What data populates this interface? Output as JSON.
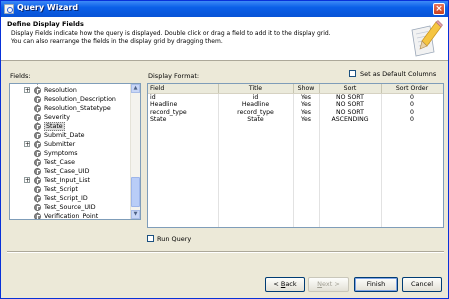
{
  "window": {
    "title": "Query Wizard",
    "close_label": "×"
  },
  "header": {
    "title": "Define Display Fields",
    "description_line1": "Display Fields indicate how the query is displayed. Double click or drag a field to add it to the display grid.",
    "description_line2": "You can also rearrange the fields in the display grid by dragging them."
  },
  "fields_panel": {
    "label": "Fields:",
    "items": [
      {
        "label": "Resolution",
        "expandable": true,
        "selected": false
      },
      {
        "label": "Resolution_Description",
        "expandable": false,
        "selected": false
      },
      {
        "label": "Resolution_Statetype",
        "expandable": false,
        "selected": false
      },
      {
        "label": "Severity",
        "expandable": false,
        "selected": false
      },
      {
        "label": "State",
        "expandable": false,
        "selected": true
      },
      {
        "label": "Submit_Date",
        "expandable": false,
        "selected": false
      },
      {
        "label": "Submitter",
        "expandable": true,
        "selected": false
      },
      {
        "label": "Symptoms",
        "expandable": false,
        "selected": false
      },
      {
        "label": "Test_Case",
        "expandable": false,
        "selected": false
      },
      {
        "label": "Test_Case_UID",
        "expandable": false,
        "selected": false
      },
      {
        "label": "Test_Input_List",
        "expandable": true,
        "selected": false
      },
      {
        "label": "Test_Script",
        "expandable": false,
        "selected": false
      },
      {
        "label": "Test_Script_ID",
        "expandable": false,
        "selected": false
      },
      {
        "label": "Test_Source_UID",
        "expandable": false,
        "selected": false
      },
      {
        "label": "Verification_Point",
        "expandable": false,
        "selected": false
      }
    ]
  },
  "display_panel": {
    "label": "Display Format:",
    "default_columns_label": "Set as Default Columns",
    "columns": [
      "Field",
      "Title",
      "Show",
      "Sort",
      "Sort Order"
    ],
    "rows": [
      [
        "id",
        "id",
        "Yes",
        "NO SORT",
        "0"
      ],
      [
        "Headline",
        "Headline",
        "Yes",
        "NO SORT",
        "0"
      ],
      [
        "record_type",
        "record_type",
        "Yes",
        "NO SORT",
        "0"
      ],
      [
        "State",
        "State",
        "Yes",
        "ASCENDING",
        "0"
      ]
    ]
  },
  "run_query_label": "Run Query",
  "buttons": {
    "back_prefix": "< ",
    "back_key": "B",
    "back_rest": "ack",
    "next_key": "N",
    "next_rest": "ext >",
    "finish_label": "Finish",
    "cancel_label": "Cancel"
  },
  "colors": {
    "title_bar": "#0a5fe8",
    "face": "#ece9d8",
    "selection": "#dcdcdc"
  }
}
